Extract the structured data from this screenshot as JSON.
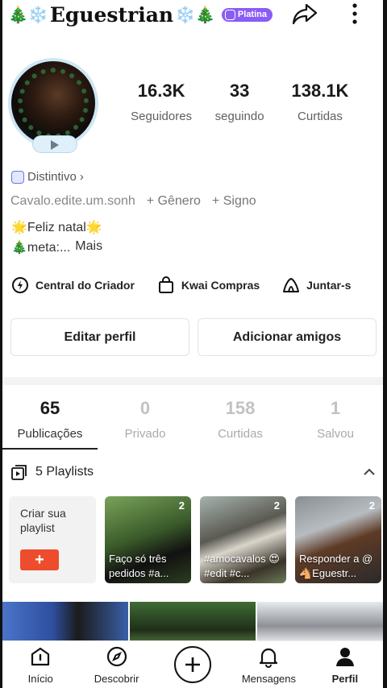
{
  "header": {
    "deco_left": "🎄❄️",
    "title": "Eguestrian",
    "deco_right": "❄️🎄",
    "badge": "Platina",
    "icons": [
      "share-icon",
      "more-icon"
    ]
  },
  "stats": [
    {
      "value": "16.3K",
      "label": "Seguidores"
    },
    {
      "value": "33",
      "label": "seguindo"
    },
    {
      "value": "138.1K",
      "label": "Curtidas"
    }
  ],
  "profile": {
    "distintivo": "Distintivo",
    "distintivo_arrow": "›",
    "username_link": "Cavalo.edite.um.sonh",
    "genero": "+ Gênero",
    "signo": "+ Signo",
    "bio_line1": "🌟Feliz natal🌟",
    "bio_line2": "🎄meta:...",
    "bio_more": "Mais"
  },
  "shortcuts": [
    {
      "label": "Central do Criador",
      "icon": "creator-center-icon"
    },
    {
      "label": "Kwai Compras",
      "icon": "shopping-bag-icon"
    },
    {
      "label": "Juntar-s",
      "icon": "tent-icon"
    }
  ],
  "buttons": {
    "edit": "Editar perfil",
    "add_friends": "Adicionar amigos"
  },
  "tabs": [
    {
      "value": "65",
      "label": "Publicações"
    },
    {
      "value": "0",
      "label": "Privado"
    },
    {
      "value": "158",
      "label": "Curtidas"
    },
    {
      "value": "1",
      "label": "Salvou"
    }
  ],
  "playlists": {
    "header": "5 Playlists",
    "create_label": "Criar sua playlist",
    "create_button": "+",
    "items": [
      {
        "count": "2",
        "caption": "Faço só três pedidos #a..."
      },
      {
        "count": "2",
        "caption": "#amocavalos 😍 #edit #c..."
      },
      {
        "count": "2",
        "caption": "Responder a @🐴Eguestr..."
      }
    ]
  },
  "nav": [
    {
      "label": "Início",
      "icon": "home-icon"
    },
    {
      "label": "Descobrir",
      "icon": "compass-icon"
    },
    {
      "label": "",
      "icon": "plus-icon"
    },
    {
      "label": "Mensagens",
      "icon": "bell-icon"
    },
    {
      "label": "Perfil",
      "icon": "person-icon"
    }
  ]
}
